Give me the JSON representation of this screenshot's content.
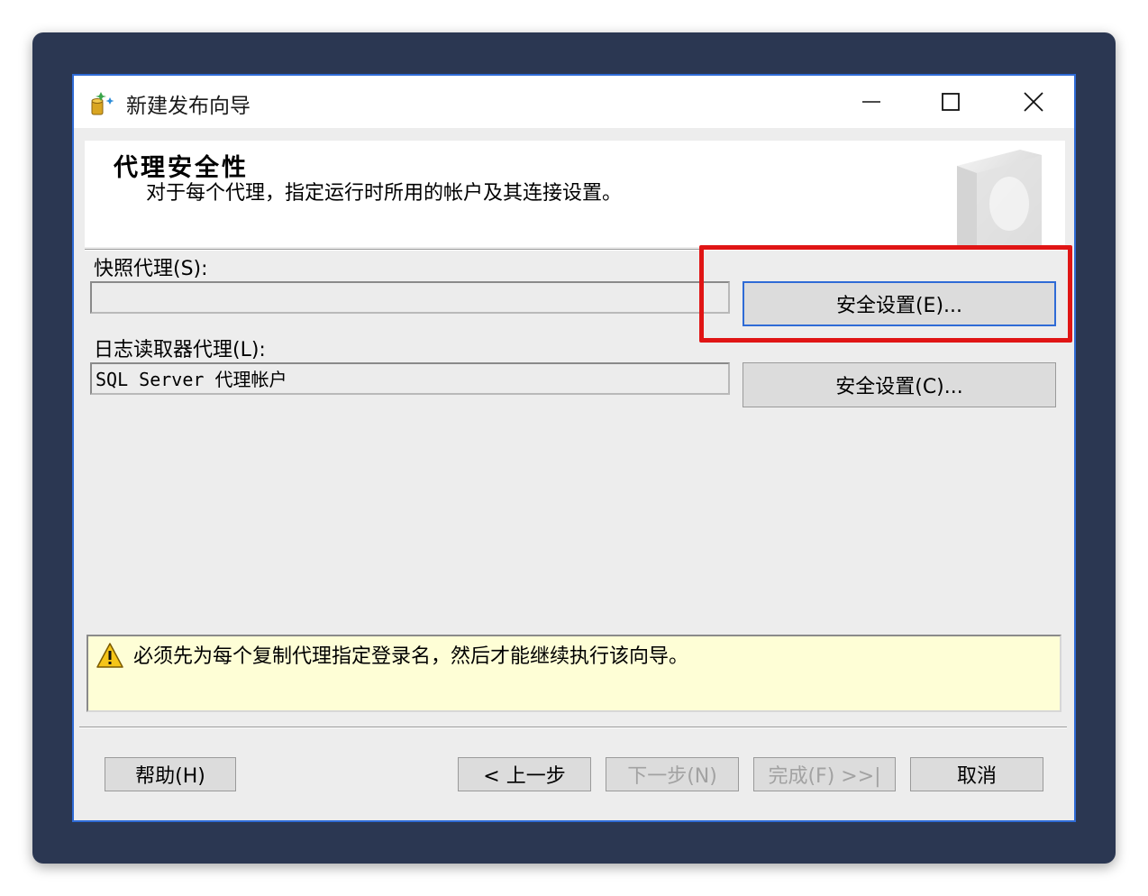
{
  "window": {
    "title": "新建发布向导",
    "controls": {
      "minimize": "minimize-icon",
      "maximize": "maximize-icon",
      "close": "close-icon"
    }
  },
  "header": {
    "title": "代理安全性",
    "subtitle": "对于每个代理，指定运行时所用的帐户及其连接设置。"
  },
  "snapshot_agent": {
    "label": "快照代理(S):",
    "value": "",
    "button": "安全设置(E)..."
  },
  "log_reader_agent": {
    "label": "日志读取器代理(L):",
    "value": "SQL Server 代理帐户",
    "button": "安全设置(C)..."
  },
  "warning": {
    "icon": "warning-icon",
    "text": "必须先为每个复制代理指定登录名，然后才能继续执行该向导。"
  },
  "footer": {
    "help": "帮助(H)",
    "back": "< 上一步",
    "next": "下一步(N)",
    "finish": "完成(F) >>|",
    "cancel": "取消"
  },
  "colors": {
    "frame": "#2b3752",
    "window_border": "#2f6bd6",
    "highlight": "#e01515",
    "warning_bg": "#fefed6"
  }
}
